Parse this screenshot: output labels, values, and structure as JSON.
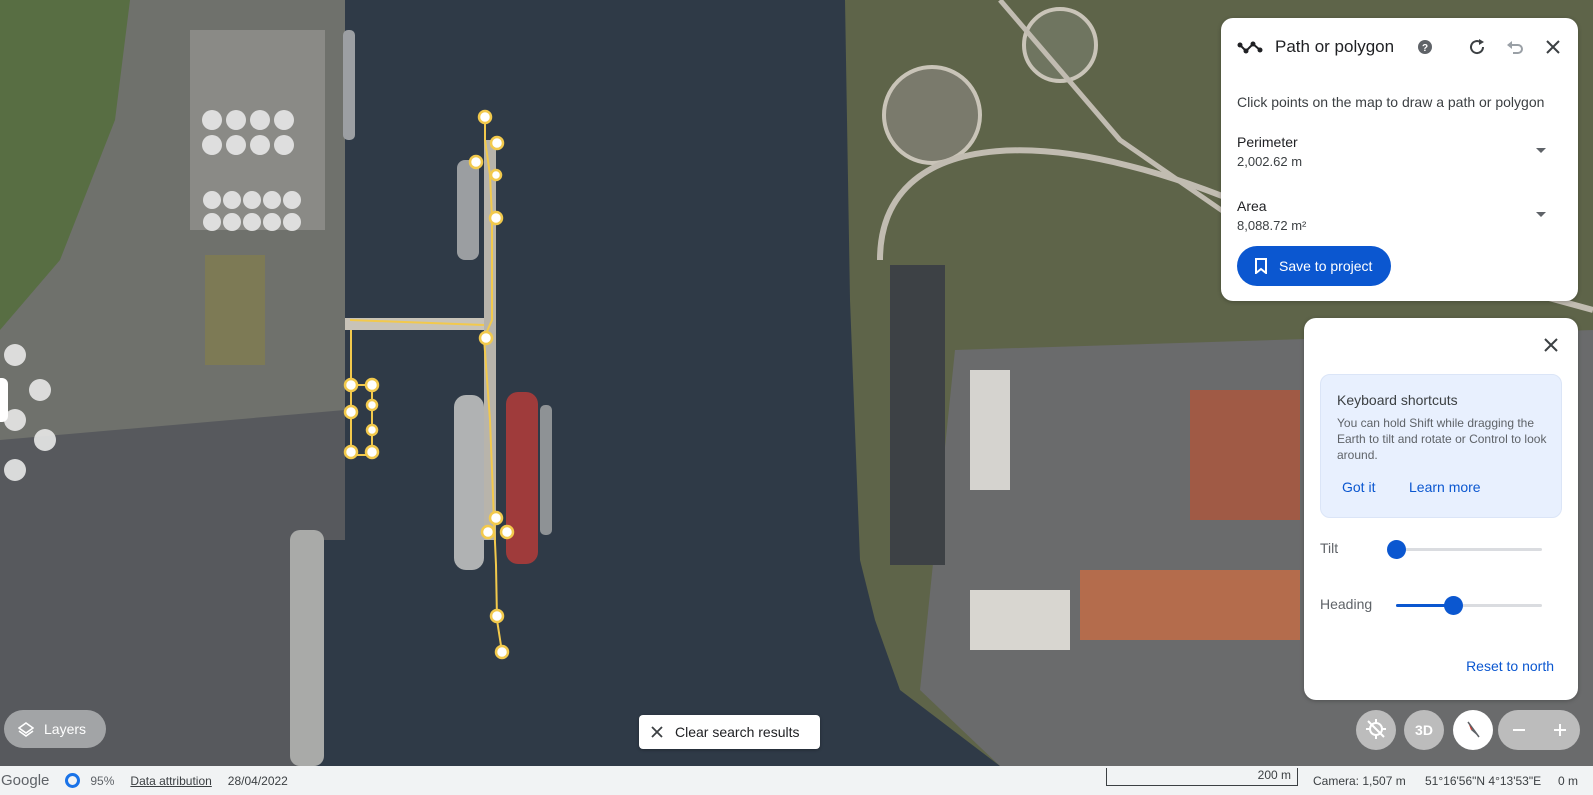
{
  "path_panel": {
    "title": "Path or polygon",
    "description": "Click points on the map to draw a path or polygon",
    "perimeter": {
      "label": "Perimeter",
      "value": "2,002.62 m"
    },
    "area": {
      "label": "Area",
      "value": "8,088.72 m²"
    },
    "save_label": "Save to project",
    "icons": [
      "polyline-icon",
      "help-icon",
      "refresh-icon",
      "undo-icon",
      "close-icon"
    ]
  },
  "nav_panel": {
    "shortcuts_title": "Keyboard shortcuts",
    "shortcuts_body": "You can hold Shift while dragging the Earth to tilt and rotate or Control to look around.",
    "got_it": "Got it",
    "learn_more": "Learn more",
    "tilt_label": "Tilt",
    "tilt_value": 0,
    "heading_label": "Heading",
    "heading_value": 0.39,
    "reset_label": "Reset to north"
  },
  "bottom": {
    "layers_label": "Layers",
    "clear_label": "Clear search results",
    "view_3d_label": "3D"
  },
  "status_bar": {
    "brand": "Google",
    "load_percent": "95%",
    "attribution": "Data attribution",
    "date": "28/04/2022",
    "scale": "200 m",
    "camera": "Camera: 1,507 m",
    "coords": "51°16'56\"N 4°13'53\"E",
    "elevation": "0 m"
  },
  "colors": {
    "accent": "#0b57d0",
    "path_line": "#f2c94c",
    "water": "#2f3a47"
  }
}
